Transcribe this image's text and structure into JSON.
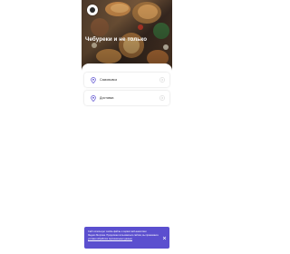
{
  "hero": {
    "title": "Чебуреки и не только"
  },
  "options": [
    {
      "label": "Самовывоз",
      "icon": "pickup-icon"
    },
    {
      "label": "Доставка",
      "icon": "delivery-icon"
    }
  ],
  "notice": {
    "text": "Сайт использует cookie-файлы и сервис веб-аналитики Яндекс.Метрика. Продолжая пользоваться сайтом, вы принимаете",
    "link": "условия обработки персональных данных",
    "close_icon": "close-icon"
  },
  "colors": {
    "accent": "#5b4fcf",
    "card_bg": "#ffffff",
    "text": "#333333"
  }
}
